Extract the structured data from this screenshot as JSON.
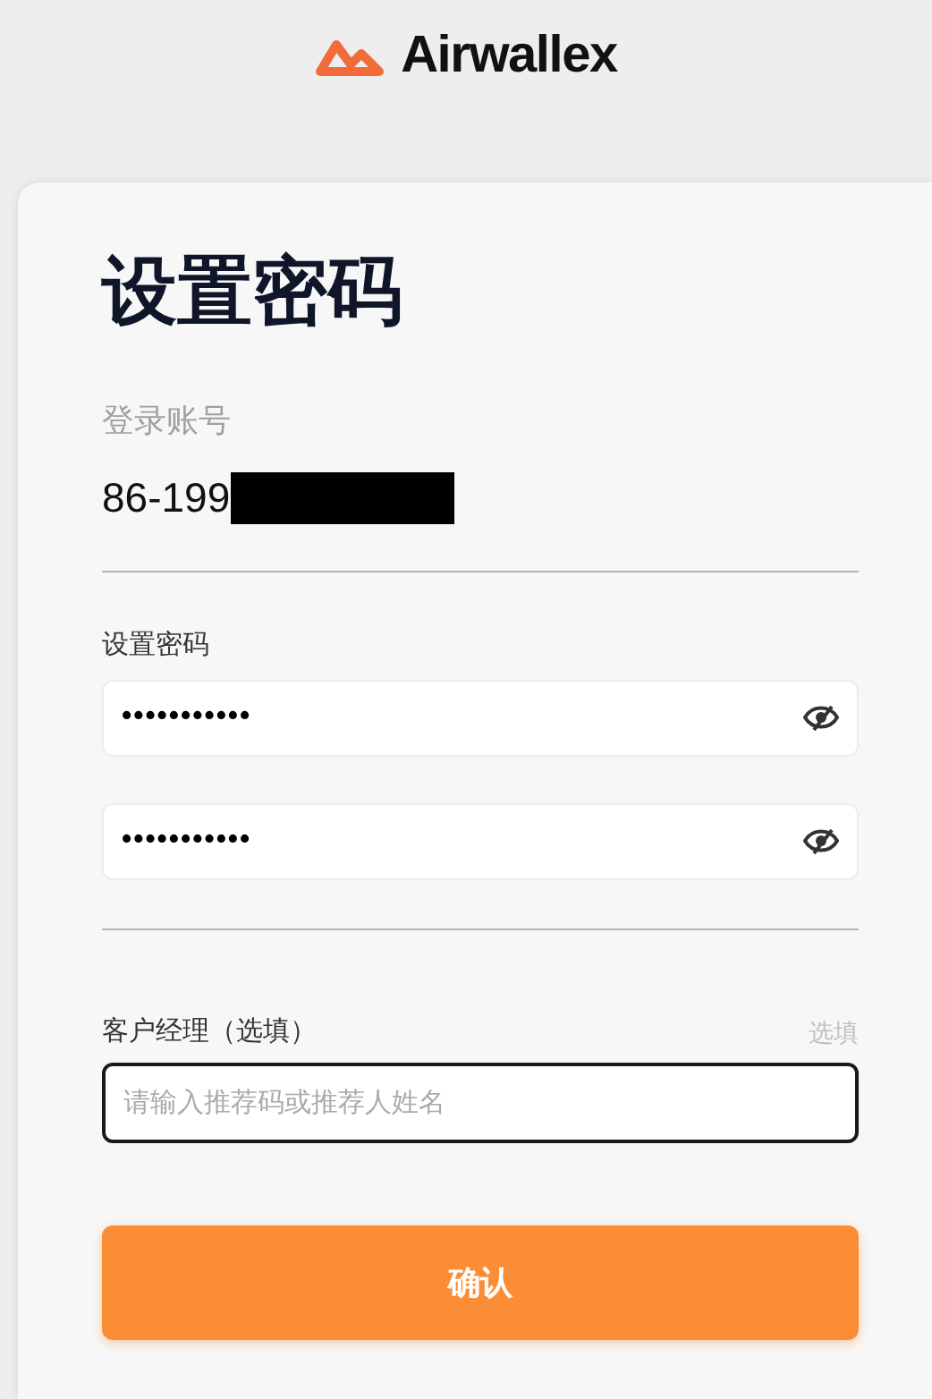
{
  "brand": {
    "name": "Airwallex"
  },
  "title": "设置密码",
  "account": {
    "label": "登录账号",
    "value": "86-199",
    "redacted": true
  },
  "password": {
    "label": "设置密码",
    "fields": [
      {
        "value": "•••••••••••",
        "masked": true
      },
      {
        "value": "•••••••••••",
        "masked": true
      }
    ]
  },
  "manager": {
    "label": "客户经理（选填）",
    "hint": "选填",
    "placeholder": "请输入推荐码或推荐人姓名",
    "focused": true
  },
  "submit": "确认"
}
